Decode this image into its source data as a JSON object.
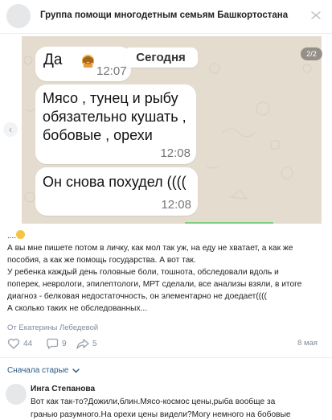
{
  "header": {
    "group_title": "Группа помощи многодетным семьям Башкортостана",
    "more_icon": "more-horizontal-icon"
  },
  "chat_image": {
    "counter": "2/2",
    "prev_icon": "chevron-left-icon",
    "messages": [
      {
        "text": "Да",
        "emoji": "woman-facepalming-emoji",
        "time": "12:07"
      },
      {
        "text": "Мясо , тунец и рыбу обязательно кушать , бобовые , орехи",
        "time": "12:08"
      },
      {
        "text": "Он снова похудел ((((",
        "time": "12:08"
      }
    ],
    "date_label": "Сегодня"
  },
  "post": {
    "emoji_line": "....",
    "body": [
      "А вы мне пишете потом в личку, как мол так уж, на еду не хватает, а как же",
      "пособия, а как же помощь государства. А вот так.",
      "У ребенка каждый день головные боли, тошнота, обследовали вдоль и",
      "поперек, неврологи, эпилептологи, МРТ сделали, все анализы взяли, в итоге",
      "диагноз - белковая недостаточность, он элементарно не доедает((((",
      "А сколько таких не обследованных..."
    ],
    "author_line": "От Екатерины Лебедевой",
    "likes": "44",
    "comments": "9",
    "shares": "5",
    "date": "8 мая"
  },
  "comments_section": {
    "sort_label": "Сначала старые",
    "comment": {
      "author": "Инга Степанова",
      "lines": [
        "Вот как так-то?Дожили,блин.Мясо-космос цены,рыба вообще за",
        "гранью разумного.На орехи цены видели?Могу немного на бобовые"
      ]
    }
  },
  "colors": {
    "link": "#2a5885",
    "muted": "#818c99",
    "chat_background": "#e4dccf",
    "accent_green": "#7fd07e"
  }
}
